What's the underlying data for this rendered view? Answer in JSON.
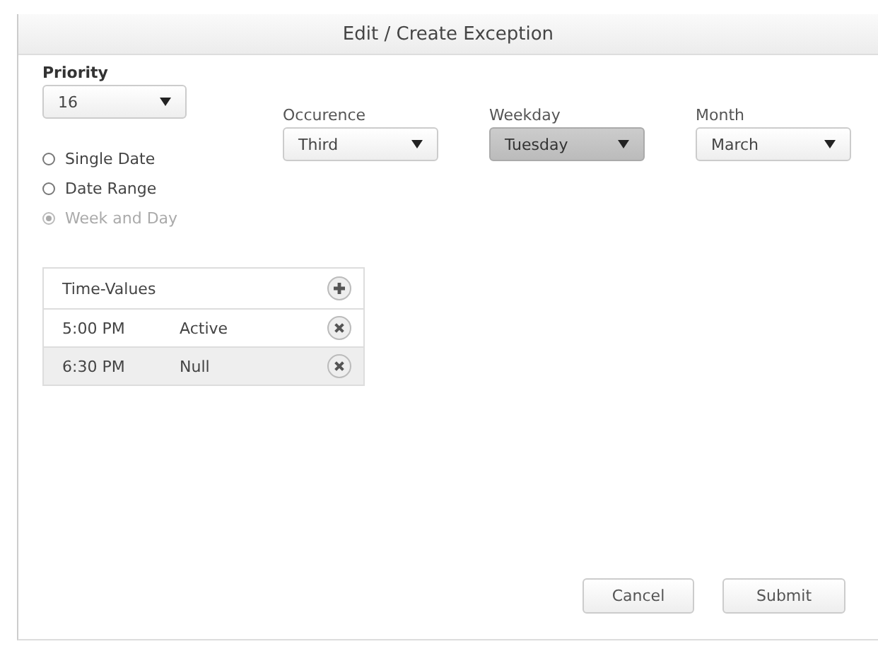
{
  "window": {
    "title": "Edit / Create Exception"
  },
  "priority": {
    "label": "Priority",
    "value": "16"
  },
  "modes": [
    {
      "label": "Single Date",
      "selected": false,
      "disabled": false
    },
    {
      "label": "Date Range",
      "selected": false,
      "disabled": false
    },
    {
      "label": "Week and Day",
      "selected": true,
      "disabled": true
    }
  ],
  "dropdowns": [
    {
      "label": "Occurence",
      "value": "Third",
      "pressed": false
    },
    {
      "label": "Weekday",
      "value": "Tuesday",
      "pressed": true
    },
    {
      "label": "Month",
      "value": "March",
      "pressed": false
    }
  ],
  "time_values": {
    "title": "Time-Values",
    "rows": [
      {
        "time": "5:00 PM",
        "value": "Active",
        "selected": false
      },
      {
        "time": "6:30 PM",
        "value": "Null",
        "selected": true
      }
    ]
  },
  "buttons": [
    "Cancel",
    "Submit"
  ]
}
